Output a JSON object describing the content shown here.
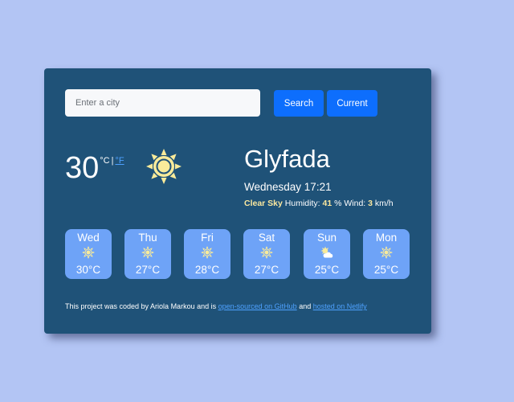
{
  "search": {
    "placeholder": "Enter a city",
    "value": "",
    "search_label": "Search",
    "current_label": "Current"
  },
  "current": {
    "temperature": "30",
    "unit_c": "°C",
    "unit_sep": "|",
    "unit_f": "°F",
    "icon": "sun-icon",
    "city": "Glyfada",
    "datetime": "Wednesday 17:21",
    "description": "Clear Sky",
    "humidity_label": "Humidity:",
    "humidity_value": "41",
    "humidity_unit": "%",
    "wind_label": "Wind:",
    "wind_value": "3",
    "wind_unit": "km/h"
  },
  "forecast": [
    {
      "day": "Wed",
      "temp": "30°C",
      "icon": "sun-icon"
    },
    {
      "day": "Thu",
      "temp": "27°C",
      "icon": "sun-icon"
    },
    {
      "day": "Fri",
      "temp": "28°C",
      "icon": "sun-icon"
    },
    {
      "day": "Sat",
      "temp": "27°C",
      "icon": "sun-icon"
    },
    {
      "day": "Sun",
      "temp": "25°C",
      "icon": "partly-cloudy-icon"
    },
    {
      "day": "Mon",
      "temp": "25°C",
      "icon": "sun-icon"
    }
  ],
  "footer": {
    "text_1": "This project was coded by Ariola Markou and is",
    "link_1": "open-sourced on GitHub",
    "text_2": "and",
    "link_2": "hosted on Netlify"
  },
  "colors": {
    "page_background": "#b3c5f4",
    "card_background": "#1f5278",
    "button": "#0d6efd",
    "forecast_tile": "#6ea3f7",
    "sun": "#f9eb9a",
    "highlight": "#f9e79f",
    "link": "#4ea1ff"
  }
}
